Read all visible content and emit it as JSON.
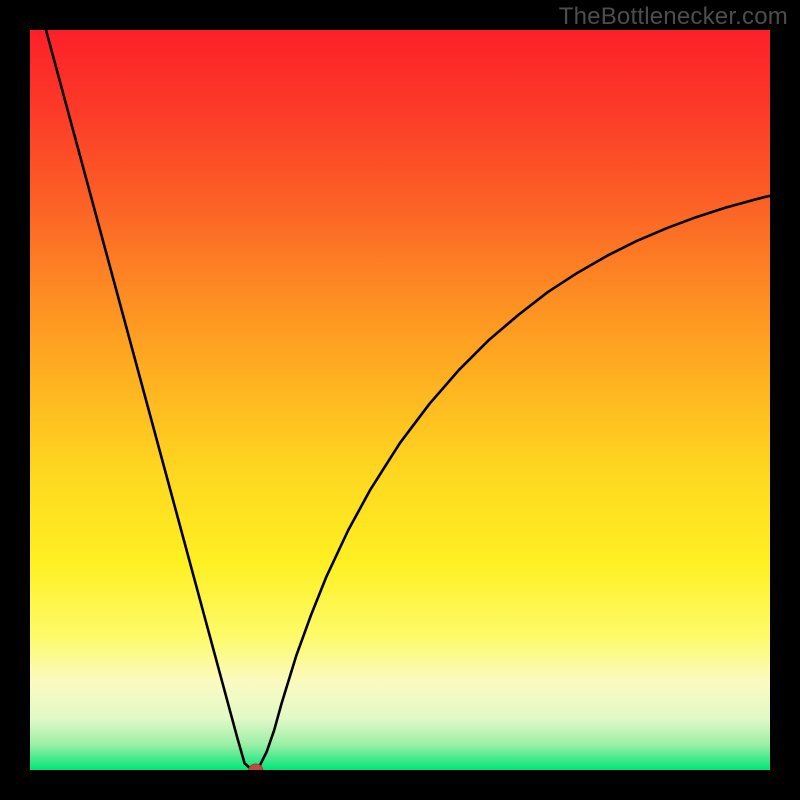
{
  "watermark": "TheBottlenecker.com",
  "colors": {
    "background": "#000000",
    "curve": "#000000",
    "marker": "#bb4b43",
    "marker_edge": "#a93b35",
    "watermark": "#4d4d4d",
    "gradient_stops": [
      {
        "offset": 0.0,
        "color": "#fc2029"
      },
      {
        "offset": 0.1,
        "color": "#fc3828"
      },
      {
        "offset": 0.22,
        "color": "#fc5c26"
      },
      {
        "offset": 0.35,
        "color": "#fd8a23"
      },
      {
        "offset": 0.48,
        "color": "#feb420"
      },
      {
        "offset": 0.6,
        "color": "#fed820"
      },
      {
        "offset": 0.72,
        "color": "#fef022"
      },
      {
        "offset": 0.82,
        "color": "#fdfb6a"
      },
      {
        "offset": 0.88,
        "color": "#fbfac0"
      },
      {
        "offset": 0.93,
        "color": "#e3f9c8"
      },
      {
        "offset": 0.965,
        "color": "#9cf0a7"
      },
      {
        "offset": 0.99,
        "color": "#2de885"
      },
      {
        "offset": 1.0,
        "color": "#00e676"
      }
    ]
  },
  "chart_data": {
    "type": "line",
    "title": "",
    "xlabel": "",
    "ylabel": "",
    "xlim": [
      0,
      100
    ],
    "ylim": [
      0,
      100
    ],
    "grid": false,
    "legend": false,
    "series": [
      {
        "name": "bottleneck_curve",
        "x": [
          0,
          2,
          4,
          6,
          8,
          10,
          12,
          14,
          16,
          18,
          20,
          22,
          24,
          26,
          28,
          29,
          30,
          30.5,
          31,
          32,
          33,
          34,
          36,
          38,
          40,
          43,
          46,
          50,
          54,
          58,
          62,
          66,
          70,
          74,
          78,
          82,
          86,
          90,
          94,
          98,
          100
        ],
        "y": [
          108,
          100.6,
          93.2,
          85.8,
          78.4,
          71,
          63.6,
          56.2,
          48.8,
          41.4,
          34,
          26.6,
          19.2,
          11.8,
          4.4,
          0.9,
          0,
          0,
          0.5,
          2.5,
          5.4,
          9,
          15.5,
          21,
          26,
          32.4,
          37.9,
          44.2,
          49.5,
          54.1,
          58.1,
          61.5,
          64.6,
          67.2,
          69.5,
          71.5,
          73.2,
          74.7,
          76,
          77.1,
          77.6
        ]
      }
    ],
    "marker": {
      "x": 30.5,
      "y": 0
    }
  }
}
